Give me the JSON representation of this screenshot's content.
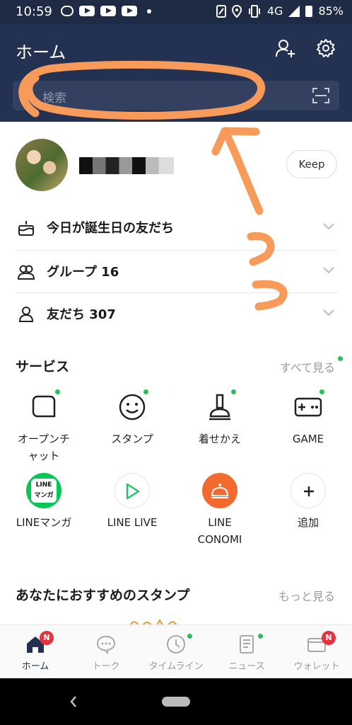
{
  "status_bar": {
    "time": "10:59",
    "network": "4G",
    "battery": "85%"
  },
  "header": {
    "title": "ホーム",
    "icons": [
      "add-friend-icon",
      "gear-icon"
    ]
  },
  "search": {
    "placeholder": "検索",
    "icons": [
      "search-icon",
      "qr-scan-icon"
    ]
  },
  "profile": {
    "keep_label": "Keep"
  },
  "rows": [
    {
      "label": "今日が誕生日の友だち",
      "icon": "cake-icon"
    },
    {
      "label": "グループ 16",
      "icon": "group-icon"
    },
    {
      "label": "友だち 307",
      "icon": "person-icon"
    }
  ],
  "services": {
    "title": "サービス",
    "see_all": "すべて見る",
    "items": [
      {
        "label": "オープンチ\nャット",
        "icon": "open-chat-icon"
      },
      {
        "label": "スタンプ",
        "icon": "smile-icon"
      },
      {
        "label": "着せかえ",
        "icon": "brush-icon"
      },
      {
        "label": "GAME",
        "icon": "gamepad-icon"
      },
      {
        "label": "LINEマンガ",
        "icon": "line-manga-icon",
        "logo_line1": "LINE",
        "logo_line2": "マンガ"
      },
      {
        "label": "LINE LIVE",
        "icon": "line-live-icon"
      },
      {
        "label": "LINE\nCONOMI",
        "icon": "line-conomi-icon"
      },
      {
        "label": "追加",
        "icon": "plus-icon"
      }
    ]
  },
  "recommend": {
    "title": "あなたにおすすめのスタンプ",
    "see_more": "もっと見る"
  },
  "bottom_nav": [
    {
      "label": "ホーム",
      "icon": "home-icon",
      "badge": "N",
      "active": true
    },
    {
      "label": "トーク",
      "icon": "chat-bubble-icon"
    },
    {
      "label": "タイムライン",
      "icon": "clock-icon"
    },
    {
      "label": "ニュース",
      "icon": "news-icon"
    },
    {
      "label": "ウォレット",
      "icon": "wallet-icon",
      "badge": "N"
    }
  ],
  "colors": {
    "header_bg": "#233152",
    "accent_green": "#2dbd5a",
    "badge_red": "#e8313f",
    "annotation_orange": "#f79a5a"
  }
}
